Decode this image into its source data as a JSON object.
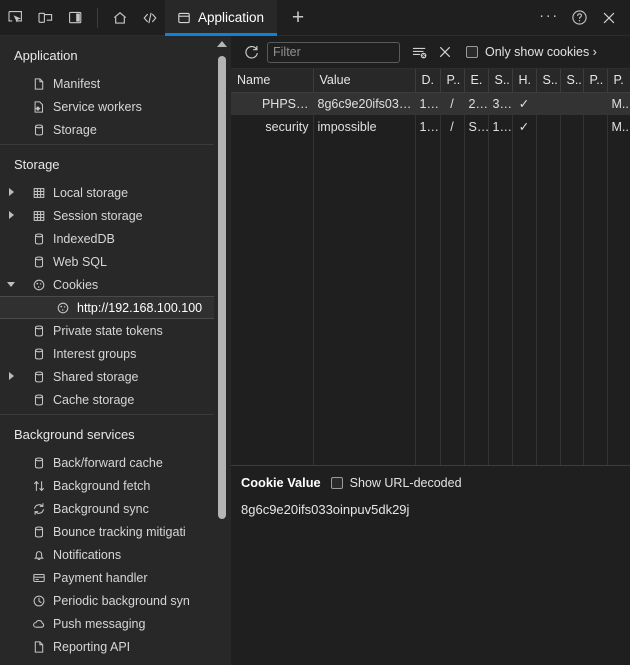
{
  "topbar": {
    "left_buttons": [
      {
        "name": "inspect-element-icon",
        "title": "Inspect"
      },
      {
        "name": "device-toolbar-icon",
        "title": "Toggle device toolbar"
      },
      {
        "name": "dock-side-icon",
        "title": "Dock side"
      }
    ],
    "nav_buttons": [
      {
        "name": "home-icon",
        "title": "Home"
      },
      {
        "name": "sources-code-icon",
        "title": "Sources"
      }
    ],
    "tab": {
      "label": "Application",
      "icon": "application-panel-icon",
      "active": true
    },
    "add_tab_label": "+",
    "more_label": "···",
    "help_label": "?",
    "close_label": "×",
    "accent_color": "#0b83d9"
  },
  "sidebar": {
    "sections": [
      {
        "title": "Application",
        "items": [
          {
            "label": "Manifest",
            "icon": "document-icon",
            "twisty": "none",
            "level": 1,
            "selected": false
          },
          {
            "label": "Service workers",
            "icon": "service-worker-icon",
            "twisty": "none",
            "level": 1,
            "selected": false
          },
          {
            "label": "Storage",
            "icon": "database-icon",
            "twisty": "none",
            "level": 1,
            "selected": false
          }
        ]
      },
      {
        "title": "Storage",
        "items": [
          {
            "label": "Local storage",
            "icon": "table-icon",
            "twisty": "closed",
            "level": 1,
            "selected": false
          },
          {
            "label": "Session storage",
            "icon": "table-icon",
            "twisty": "closed",
            "level": 1,
            "selected": false
          },
          {
            "label": "IndexedDB",
            "icon": "database-icon",
            "twisty": "none",
            "level": 1,
            "selected": false
          },
          {
            "label": "Web SQL",
            "icon": "database-icon",
            "twisty": "none",
            "level": 1,
            "selected": false
          },
          {
            "label": "Cookies",
            "icon": "cookie-icon",
            "twisty": "open",
            "level": 1,
            "selected": false
          },
          {
            "label": "http://192.168.100.100",
            "icon": "cookie-icon",
            "twisty": "none",
            "level": 2,
            "selected": true
          },
          {
            "label": "Private state tokens",
            "icon": "database-icon",
            "twisty": "none",
            "level": 1,
            "selected": false
          },
          {
            "label": "Interest groups",
            "icon": "database-icon",
            "twisty": "none",
            "level": 1,
            "selected": false
          },
          {
            "label": "Shared storage",
            "icon": "database-icon",
            "twisty": "closed",
            "level": 1,
            "selected": false
          },
          {
            "label": "Cache storage",
            "icon": "database-icon",
            "twisty": "none",
            "level": 1,
            "selected": false
          }
        ]
      },
      {
        "title": "Background services",
        "items": [
          {
            "label": "Back/forward cache",
            "icon": "database-icon",
            "twisty": "none",
            "level": 1,
            "selected": false
          },
          {
            "label": "Background fetch",
            "icon": "arrows-updown-icon",
            "twisty": "none",
            "level": 1,
            "selected": false
          },
          {
            "label": "Background sync",
            "icon": "sync-icon",
            "twisty": "none",
            "level": 1,
            "selected": false
          },
          {
            "label": "Bounce tracking mitigati",
            "icon": "database-icon",
            "twisty": "none",
            "level": 1,
            "selected": false
          },
          {
            "label": "Notifications",
            "icon": "bell-icon",
            "twisty": "none",
            "level": 1,
            "selected": false
          },
          {
            "label": "Payment handler",
            "icon": "credit-card-icon",
            "twisty": "none",
            "level": 1,
            "selected": false
          },
          {
            "label": "Periodic background syn",
            "icon": "clock-icon",
            "twisty": "none",
            "level": 1,
            "selected": false
          },
          {
            "label": "Push messaging",
            "icon": "cloud-icon",
            "twisty": "none",
            "level": 1,
            "selected": false
          },
          {
            "label": "Reporting API",
            "icon": "document-icon",
            "twisty": "none",
            "level": 1,
            "selected": false
          }
        ]
      }
    ]
  },
  "cookie_toolbar": {
    "refresh_icon": "refresh-icon",
    "filter_placeholder": "Filter",
    "filter_value": "",
    "clear_filter_icon": "clear-filter-icon",
    "clear_all_icon": "clear-all-cookies-icon",
    "checkbox": {
      "label": "Only show cookies ›",
      "checked": false
    }
  },
  "table": {
    "columns": [
      "Name",
      "Value",
      "D.",
      "P..",
      "E.",
      "S..",
      "H.",
      "S..",
      "S..",
      "P..",
      "P."
    ],
    "rows": [
      {
        "selected": true,
        "cells": [
          "PHPS…",
          "8g6c9e20ifs03…",
          "1…",
          "/",
          "2…",
          "3…",
          "✓",
          "",
          "",
          "",
          "M.."
        ]
      },
      {
        "selected": false,
        "cells": [
          "security",
          "impossible",
          "1…",
          "/",
          "S…",
          "1…",
          "✓",
          "",
          "",
          "",
          "M.."
        ]
      }
    ]
  },
  "detail": {
    "title": "Cookie Value",
    "url_decoded_label": "Show URL-decoded",
    "url_decoded_checked": false,
    "value": "8g6c9e20ifs033oinpuv5dk29j"
  }
}
